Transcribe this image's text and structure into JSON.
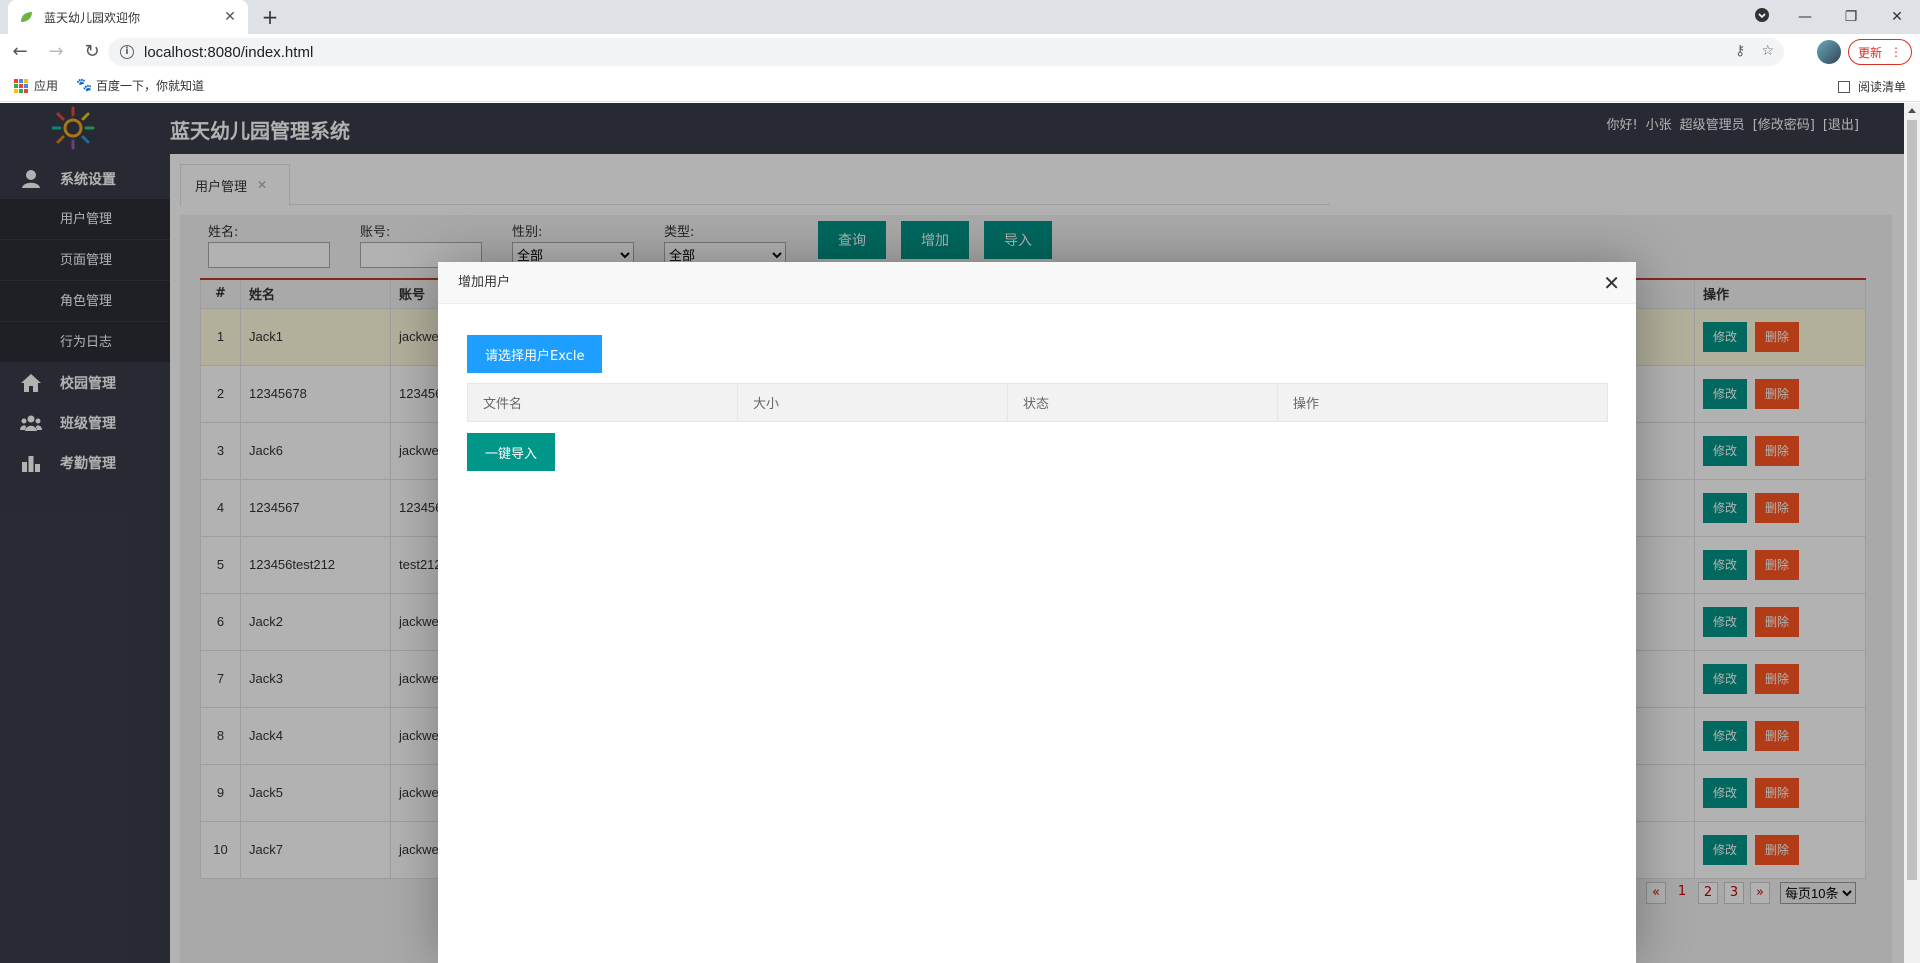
{
  "browser": {
    "tab_title": "蓝天幼儿园欢迎你",
    "url": "localhost:8080/index.html",
    "update_label": "更新",
    "bookmarks": [
      {
        "label": "应用"
      },
      {
        "label": "百度一下，你就知道"
      }
    ],
    "reading_list": "阅读清单"
  },
  "header": {
    "title": "蓝天幼儿园管理系统",
    "greeting": "你好!",
    "username": "小张",
    "role": "超级管理员",
    "change_password": "[修改密码]",
    "logout": "[退出]"
  },
  "sidebar": {
    "groups": [
      {
        "label": "系统设置",
        "icon": "user-icon",
        "items": [
          {
            "label": "用户管理"
          },
          {
            "label": "页面管理"
          },
          {
            "label": "角色管理"
          },
          {
            "label": "行为日志"
          }
        ]
      },
      {
        "label": "校园管理",
        "icon": "home-icon"
      },
      {
        "label": "班级管理",
        "icon": "group-icon"
      },
      {
        "label": "考勤管理",
        "icon": "bar-chart-icon"
      }
    ]
  },
  "page_tab": {
    "label": "用户管理"
  },
  "filter": {
    "name_label": "姓名:",
    "account_label": "账号:",
    "gender_label": "性别:",
    "gender_value": "全部",
    "type_label": "类型:",
    "type_value": "全部",
    "query": "查询",
    "add": "增加",
    "import": "导入"
  },
  "table": {
    "columns": [
      "#",
      "姓名",
      "账号",
      "操作"
    ],
    "edit": "修改",
    "delete": "删除",
    "rows": [
      {
        "n": "1",
        "name": "Jack1",
        "account": "jackwe"
      },
      {
        "n": "2",
        "name": "12345678",
        "account": "123456"
      },
      {
        "n": "3",
        "name": "Jack6",
        "account": "jackwe"
      },
      {
        "n": "4",
        "name": "1234567",
        "account": "123456"
      },
      {
        "n": "5",
        "name": "123456test212",
        "account": "test212"
      },
      {
        "n": "6",
        "name": "Jack2",
        "account": "jackwe"
      },
      {
        "n": "7",
        "name": "Jack3",
        "account": "jackwe"
      },
      {
        "n": "8",
        "name": "Jack4",
        "account": "jackwe"
      },
      {
        "n": "9",
        "name": "Jack5",
        "account": "jackwe"
      },
      {
        "n": "10",
        "name": "Jack7",
        "account": "jackwe"
      }
    ]
  },
  "pager": {
    "prev": "«",
    "pages": [
      "1",
      "2",
      "3"
    ],
    "next": "»",
    "per_page": "每页10条"
  },
  "modal": {
    "title": "增加用户",
    "choose_file": "请选择用户Excle",
    "columns": [
      "文件名",
      "大小",
      "状态",
      "操作"
    ],
    "import_all": "一键导入"
  }
}
